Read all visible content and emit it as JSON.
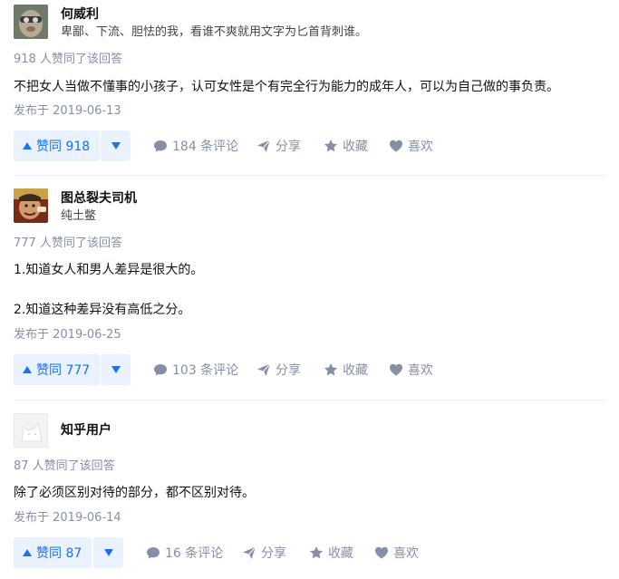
{
  "answers": [
    {
      "author_name": "何威利",
      "author_bio": "卑鄙、下流、胆怯的我，看谁不爽就用文字为匕首背刺谁。",
      "votes_text": "918 人赞同了该回答",
      "content": [
        "不把女人当做不懂事的小孩子，认可女性是个有完全行为能力的成年人，可以为自己做的事负责。"
      ],
      "date": "发布于 2019-06-13",
      "vote_label": "赞同 918",
      "comments_label": "184 条评论",
      "share_label": "分享",
      "favorite_label": "收藏",
      "like_label": "喜欢"
    },
    {
      "author_name": "图总裂夫司机",
      "author_bio": "纯土鳖",
      "votes_text": "777 人赞同了该回答",
      "content": [
        "1.知道女人和男人差异是很大的。",
        "2.知道这种差异没有高低之分。"
      ],
      "date": "发布于 2019-06-25",
      "vote_label": "赞同 777",
      "comments_label": "103 条评论",
      "share_label": "分享",
      "favorite_label": "收藏",
      "like_label": "喜欢"
    },
    {
      "author_name": "知乎用户",
      "author_bio": "",
      "votes_text": "87 人赞同了该回答",
      "content": [
        "除了必须区别对待的部分，都不区别对待。"
      ],
      "date": "发布于 2019-06-14",
      "vote_label": "赞同 87",
      "comments_label": "16 条评论",
      "share_label": "分享",
      "favorite_label": "收藏",
      "like_label": "喜欢"
    }
  ],
  "colors": {
    "accent": "#1772f6",
    "vote_bg": "#eaf2ff",
    "meta": "#8590a6",
    "divider": "#f0f2f7"
  },
  "icons": [
    "caret-up-icon",
    "caret-down-icon",
    "comment-icon",
    "share-icon",
    "star-icon",
    "heart-icon"
  ]
}
